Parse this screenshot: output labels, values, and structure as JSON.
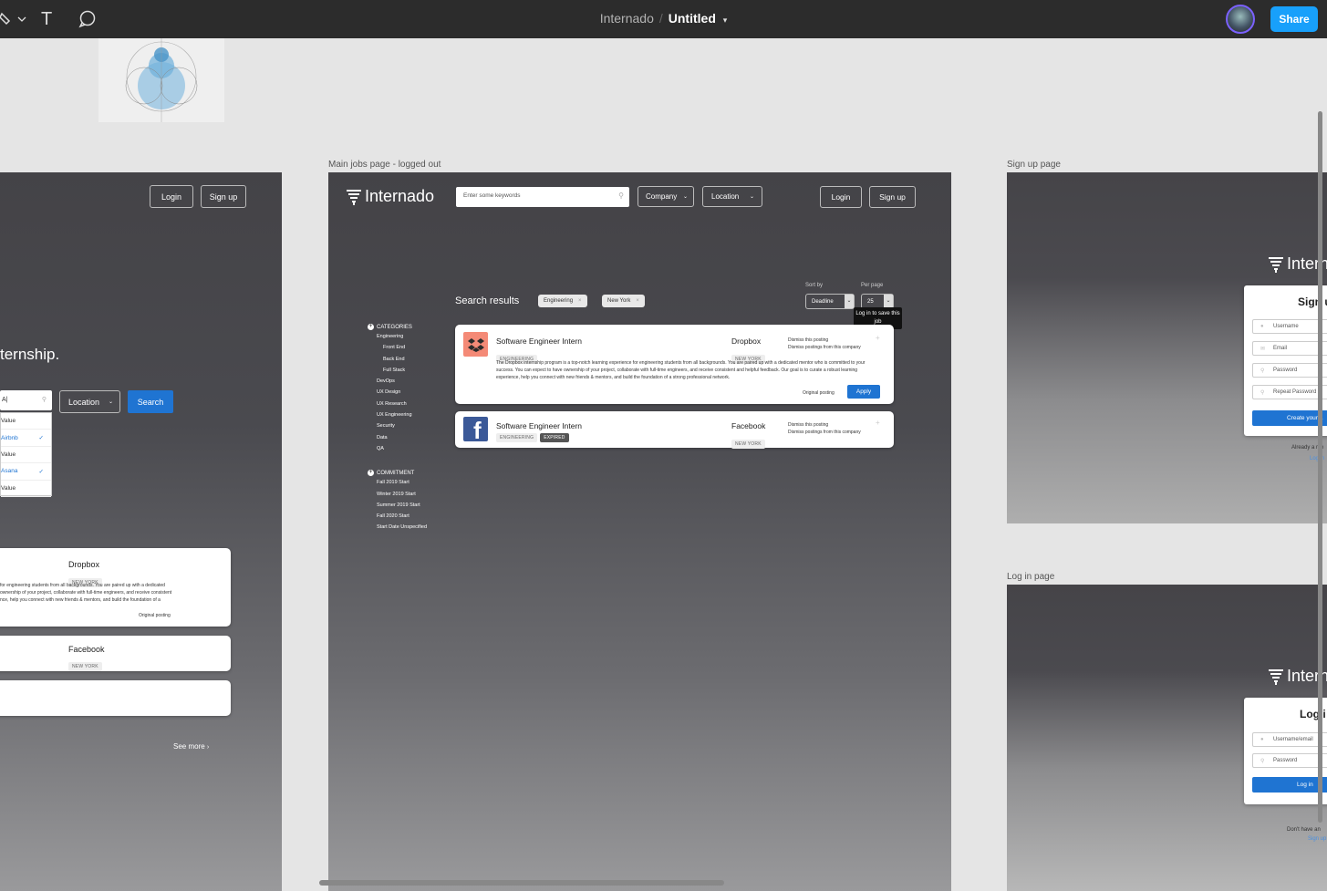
{
  "toolbar": {
    "tools": [
      "pen-tool-icon",
      "text-tool-icon",
      "comment-tool-icon"
    ],
    "text_tool": "T",
    "project": "Internado",
    "separator": "/",
    "file": "Untitled",
    "share_label": "Share"
  },
  "frames": {
    "main_label": "Main jobs page - logged out",
    "signup_label": "Sign up page",
    "login_label": "Log in page"
  },
  "left_frame": {
    "login": "Login",
    "signup": "Sign up",
    "hero_text": "ternship.",
    "search_value": "A|",
    "location": "Location",
    "search_btn": "Search",
    "dropdown": [
      {
        "label": "Value",
        "checked": false
      },
      {
        "label": "Airbnb",
        "checked": true
      },
      {
        "label": "Value",
        "checked": false
      },
      {
        "label": "Asana",
        "checked": true
      },
      {
        "label": "Value",
        "checked": false
      }
    ],
    "card1_company": "Dropbox",
    "card1_loc": "NEW YORK",
    "card1_desc_1": "for engineering students from all backgrounds. You are paired up with a dedicated",
    "card1_desc_2": "ownership of your project, collaborate with full-time engineers, and receive consistent",
    "card1_desc_3": "nce, help you connect with new friends & mentors, and build the foundation of a",
    "card1_link": "Original posting",
    "card2_company": "Facebook",
    "card2_loc": "NEW YORK",
    "see_more": "See more"
  },
  "main": {
    "logo": "Internado",
    "search_placeholder": "Enter some keywords",
    "company": "Company",
    "location": "Location",
    "login": "Login",
    "signup": "Sign up",
    "results_title": "Search results",
    "chips": [
      "Engineering",
      "New York"
    ],
    "sort_label": "Sort by",
    "sort_value": "Deadline",
    "perpage_label": "Per page",
    "perpage_value": "25",
    "tooltip": "Log in to save this job",
    "categories_title": "CATEGORIES",
    "categories": [
      "Engineering",
      "Front End",
      "Back End",
      "Full Stack",
      "DevOps",
      "UX Design",
      "UX Research",
      "UX Engineering",
      "Security",
      "Data",
      "QA"
    ],
    "commitment_title": "COMMITMENT",
    "commitments": [
      "Fall 2019 Start",
      "Winter 2019 Start",
      "Summer 2019 Start",
      "Fall 2020 Start",
      "Start Date Unspecified"
    ],
    "jobs": [
      {
        "title": "Software Engineer Intern",
        "company": "Dropbox",
        "category": "ENGINEERING",
        "location": "NEW YORK",
        "dismiss": "Dismiss this posting",
        "dismiss_company": "Dismiss postings from this company",
        "desc": "The Dropbox internship program is a top-notch learning experience for engineering students from all backgrounds. You are paired up with a dedicated mentor who is committed to your success. You can expect to have ownership of your project, collaborate with full-time engineers, and receive consistent and helpful feedback. Our goal is to curate a robust learning experience, help you connect with new friends & mentors, and build the foundation of a strong professional network.",
        "original": "Original posting",
        "apply": "Apply"
      },
      {
        "title": "Software Engineer Intern",
        "company": "Facebook",
        "category": "ENGINEERING",
        "status": "EXPIRED",
        "location": "NEW YORK",
        "dismiss": "Dismiss this posting",
        "dismiss_company": "Dismiss postings from this company"
      }
    ]
  },
  "signup": {
    "logo": "Intern",
    "title": "Sign u",
    "fields": [
      "Username",
      "Email",
      "Password",
      "Repeat Password"
    ],
    "create": "Create your a",
    "already": "Already a me",
    "login_link": "Log in"
  },
  "login": {
    "logo": "Intern",
    "title": "Log i",
    "fields": [
      "Username/email",
      "Password"
    ],
    "button": "Log in",
    "no_account": "Don't have an",
    "signup_link": "Sign up"
  }
}
